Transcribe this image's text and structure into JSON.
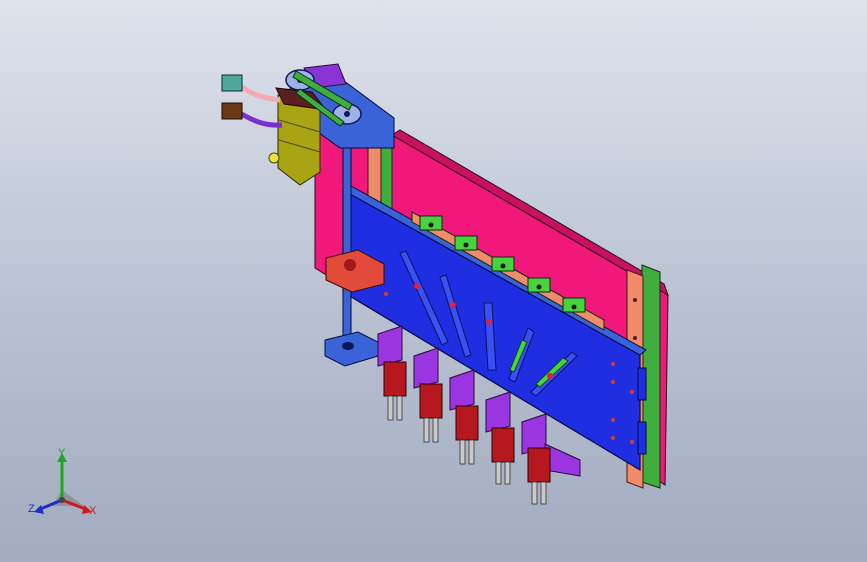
{
  "viewport": {
    "background_top": "#dfe3ec",
    "background_bottom": "#a2abbf"
  },
  "triad": {
    "x_label": "X",
    "y_label": "Y",
    "z_label": "Z",
    "x_color": "#d11a1a",
    "y_color": "#1fa51f",
    "z_color": "#1d2fc4"
  },
  "model": {
    "colors": {
      "back_plate": "#f0187a",
      "front_plate": "#1f2ee0",
      "motor": "#a8a414",
      "bracket": "#3a63d8",
      "rail_green": "#3fae3f",
      "rail_salmon": "#f08c6a",
      "blocks_purple": "#9a35e0",
      "grippers_red": "#b5181e",
      "sensors_green": "#46d33d",
      "cable_pink": "#f4a9b4",
      "cable_purple": "#7b2fd0"
    }
  }
}
